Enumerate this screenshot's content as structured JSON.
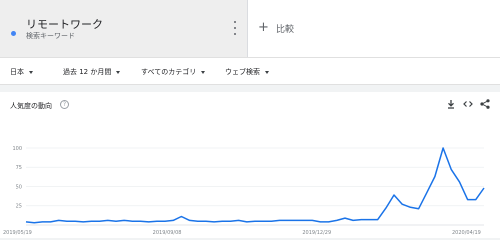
{
  "term": {
    "title": "リモートワーク",
    "subtitle": "検索キーワード",
    "color": "#4285f4",
    "menu_icon": "more-vert-icon"
  },
  "compare": {
    "icon": "plus-icon",
    "label": "比較"
  },
  "filters": [
    {
      "label": "日本"
    },
    {
      "label": "過去 12 か月間"
    },
    {
      "label": "すべてのカテゴリ"
    },
    {
      "label": "ウェブ検索"
    }
  ],
  "chart_card": {
    "title": "人気度の動向",
    "help_icon": "help-icon",
    "tools": [
      "download-icon",
      "embed-icon",
      "share-icon"
    ]
  },
  "chart_data": {
    "type": "line",
    "series_color": "#1a73e8",
    "grid": true,
    "ylim": [
      0,
      100
    ],
    "yticks": [
      "100",
      "75",
      "50",
      "25"
    ],
    "xticks": [
      "2019/05/19",
      "2019/09/08",
      "2019/12/29",
      "2020/04/19"
    ],
    "series": [
      {
        "values": [
          4,
          3,
          4,
          4,
          6,
          5,
          5,
          4,
          5,
          5,
          6,
          5,
          6,
          5,
          5,
          4,
          5,
          5,
          6,
          11,
          6,
          5,
          5,
          4,
          5,
          5,
          6,
          4,
          5,
          5,
          5,
          6,
          6,
          6,
          6,
          6,
          4,
          4,
          6,
          9,
          6,
          7,
          7,
          7,
          22,
          39,
          27,
          23,
          21,
          42,
          63,
          100,
          72,
          56,
          33,
          33,
          48
        ]
      }
    ]
  }
}
